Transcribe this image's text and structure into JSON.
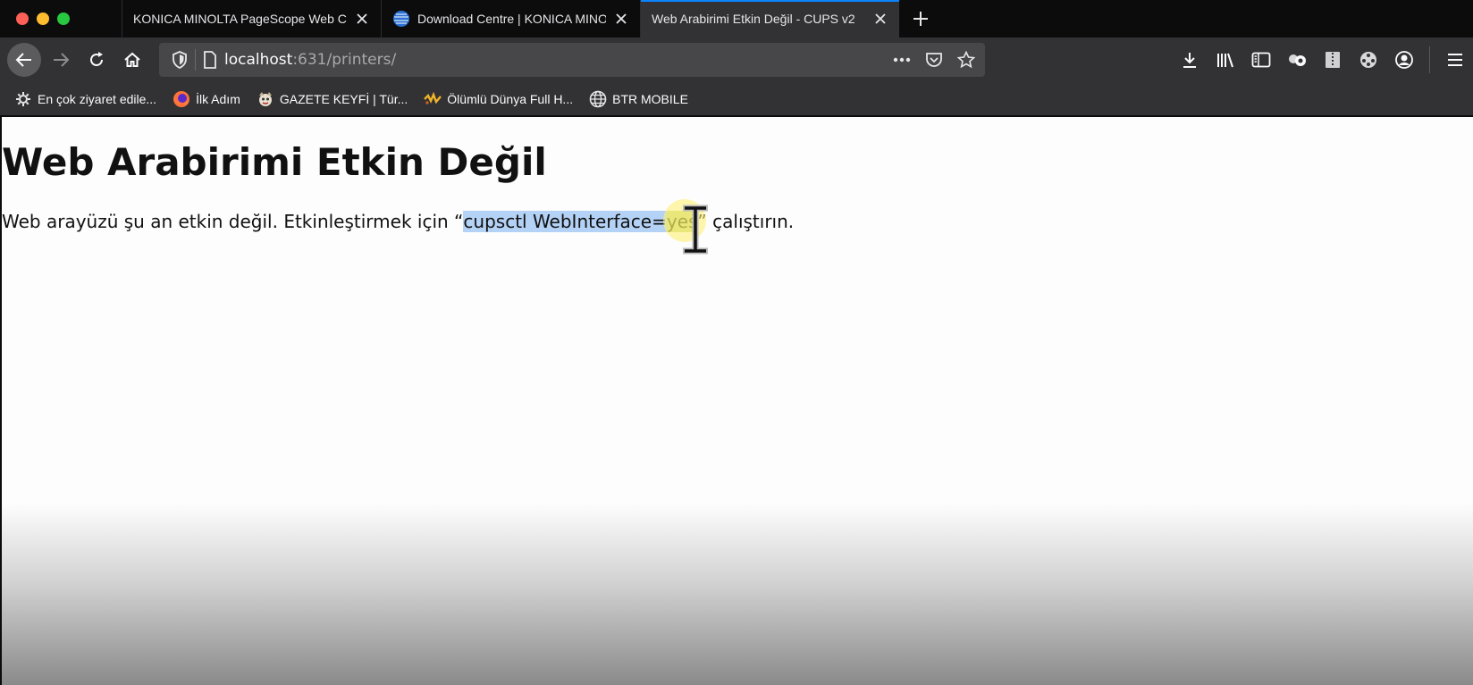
{
  "tabs": [
    {
      "label": "KONICA MINOLTA PageScope Web C",
      "active": false
    },
    {
      "label": "Download Centre | KONICA MINOLTA",
      "active": false
    },
    {
      "label": "Web Arabirimi Etkin Değil - CUPS v2",
      "active": true
    }
  ],
  "urlbar": {
    "host": "localhost",
    "rest": ":631/printers/"
  },
  "bookmarks": [
    {
      "label": "En çok ziyaret edile...",
      "icon": "gear-icon"
    },
    {
      "label": "İlk Adım",
      "icon": "firefox-icon"
    },
    {
      "label": "GAZETE KEYFİ | Tür...",
      "icon": "mascot-icon"
    },
    {
      "label": "Ölümlü Dünya Full H...",
      "icon": "logo-icon"
    },
    {
      "label": "BTR MOBILE",
      "icon": "globe-icon"
    }
  ],
  "page": {
    "title": "Web Arabirimi Etkin Değil",
    "text_before": "Web arayüzü şu an etkin değil. Etkinleştirmek için “",
    "selected_text": "cupsctl WebInterface=",
    "selected_highlight": "yes",
    "text_after": "” çalıştırın."
  },
  "colors": {
    "tab_accent": "#0a84ff",
    "selection": "#b4d2f5",
    "cursor_halo": "#fff078"
  }
}
